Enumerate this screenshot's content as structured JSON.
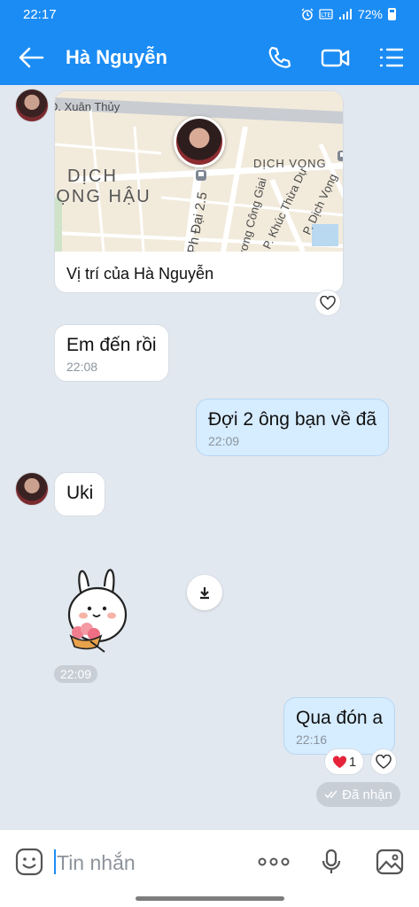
{
  "status_bar": {
    "time": "22:17",
    "battery": "72%",
    "icons": [
      "alarm-icon",
      "volte-icon",
      "signal-icon",
      "battery-icon"
    ]
  },
  "header": {
    "title": "Hà Nguyễn",
    "icons": [
      "back-arrow-icon",
      "phone-icon",
      "video-call-icon",
      "menu-icon"
    ],
    "background_color": "#1b8cf4"
  },
  "messages": {
    "location": {
      "caption": "Vị trí của Hà Nguyễn",
      "map_labels": {
        "street_top": "Đ. Xuân Thủy",
        "district_1": "DỊCH",
        "district_2": "VỌNG HẬU",
        "district_3": "DỊCH VỌNG",
        "street_1": "Ph Đại 2.5",
        "street_2": "Dương Công Giai",
        "street_3": "P. Khúc Thừa Dụ",
        "street_4": "P. Dịch Vọng"
      }
    },
    "msg1": {
      "text": "Em đến rồi",
      "time": "22:08"
    },
    "msg2": {
      "text": "Đợi 2 ông bạn về đã",
      "time": "22:09"
    },
    "msg3": {
      "text": "Uki"
    },
    "sticker": {
      "time": "22:09"
    },
    "msg4": {
      "text": "Qua đón a",
      "time": "22:16",
      "reaction_count": "1"
    },
    "status": "Đã nhận"
  },
  "composer": {
    "placeholder": "Tin nhắn",
    "icons": [
      "emoji-icon",
      "more-dots-icon",
      "microphone-icon",
      "image-icon"
    ]
  },
  "colors": {
    "accent": "#1b8cf4",
    "chat_bg": "#e2e8ef",
    "my_bubble": "#d6ecff"
  }
}
